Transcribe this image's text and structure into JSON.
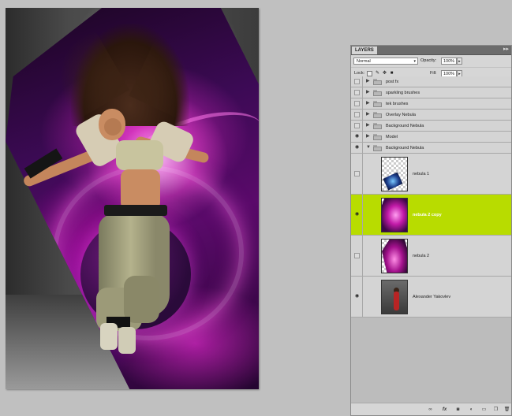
{
  "document": {
    "artwork": "dancer-nebula-composition"
  },
  "layers_panel": {
    "tab_label": "LAYERS",
    "menu_icon": "panel-menu-icon",
    "blend_mode": "Normal",
    "opacity_label": "Opacity:",
    "opacity_value": "100%",
    "lock_label": "Lock:",
    "fill_label": "Fill:",
    "fill_value": "100%",
    "layers": [
      {
        "name": "post fx",
        "kind": "group",
        "visible": false,
        "expanded": false
      },
      {
        "name": "sparkling brushes",
        "kind": "group",
        "visible": false,
        "expanded": false
      },
      {
        "name": "tek brushes",
        "kind": "group",
        "visible": false,
        "expanded": false
      },
      {
        "name": "Overlay Nebula",
        "kind": "group",
        "visible": false,
        "expanded": false
      },
      {
        "name": "Background Nebula",
        "kind": "group",
        "visible": false,
        "expanded": false
      },
      {
        "name": "Model",
        "kind": "group",
        "visible": true,
        "expanded": false
      },
      {
        "name": "Background Nebula",
        "kind": "group",
        "visible": true,
        "expanded": true
      },
      {
        "name": "nebula 1",
        "kind": "layer",
        "visible": false,
        "selected": false
      },
      {
        "name": "nebula 2 copy",
        "kind": "layer",
        "visible": true,
        "selected": true
      },
      {
        "name": "nebula 2",
        "kind": "layer",
        "visible": false,
        "selected": false
      },
      {
        "name": "Alexander Yakovlev",
        "kind": "layer",
        "visible": true,
        "selected": false
      }
    ],
    "colors": {
      "selected_row": "#b8dc00",
      "panel_bg": "#d6d6d6",
      "app_bg": "#c0c0c0"
    },
    "footer_icons": [
      "link-layers-icon",
      "fx-icon",
      "add-mask-icon",
      "adjustment-layer-icon",
      "new-group-icon",
      "new-layer-icon",
      "trash-icon"
    ]
  }
}
